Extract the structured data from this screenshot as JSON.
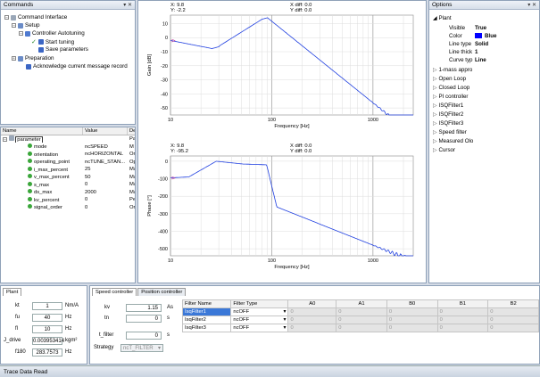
{
  "commands": {
    "title": "Commands",
    "controls": "▾ ✕",
    "tree": [
      "Command Interface",
      "Setup",
      "Controller Autotuning",
      "Start tuning",
      "Save parameters",
      "Preparation",
      "Acknowledge current message record"
    ]
  },
  "params": {
    "headers": [
      "Name",
      "Value",
      "De"
    ],
    "rows": [
      {
        "name": "parameter",
        "value": "",
        "desc": "Pa"
      },
      {
        "name": "mode",
        "value": "ncSPEED",
        "desc": "M"
      },
      {
        "name": "orientation",
        "value": "ncHORIZONTAL",
        "desc": "Ori"
      },
      {
        "name": "operating_point",
        "value": "ncTUNE_STAN...",
        "desc": "Op"
      },
      {
        "name": "i_max_percent",
        "value": "25",
        "desc": "Ma"
      },
      {
        "name": "v_max_percent",
        "value": "50",
        "desc": "Ma"
      },
      {
        "name": "s_max",
        "value": "0",
        "desc": "Ma"
      },
      {
        "name": "ds_max",
        "value": "2000",
        "desc": "Ma"
      },
      {
        "name": "kv_percent",
        "value": "0",
        "desc": "Per"
      },
      {
        "name": "signal_order",
        "value": "0",
        "desc": "On"
      }
    ]
  },
  "plot1": {
    "cursor_x": "X: 9.8",
    "cursor_y": "Y: -2.2",
    "xdiff": "X diff: 0.0",
    "ydiff": "Y diff: 0.0",
    "ylabel": "Gain [dB]",
    "xlabel": "Frequency [Hz]",
    "yticks": [
      "10",
      "0",
      "-10",
      "-20",
      "-30",
      "-40",
      "-50"
    ],
    "xticks": [
      "10",
      "100",
      "1000"
    ]
  },
  "plot2": {
    "cursor_x": "X: 9.8",
    "cursor_y": "Y: -95.2",
    "xdiff": "X diff: 0.0",
    "ydiff": "Y diff: 0.0",
    "ylabel": "Phase [°]",
    "xlabel": "Frequency [Hz]",
    "yticks": [
      "0",
      "-100",
      "-200",
      "-300",
      "-400",
      "-500"
    ],
    "xticks": [
      "10",
      "100",
      "1000"
    ]
  },
  "options": {
    "title": "Options",
    "controls": "▾ ✕",
    "plant": "Plant",
    "props": [
      {
        "k": "Visible",
        "v": "True"
      },
      {
        "k": "Color",
        "v": "Blue"
      },
      {
        "k": "Line type",
        "v": "Solid"
      },
      {
        "k": "Line thick",
        "v": "1"
      },
      {
        "k": "Curve typ",
        "v": "Line"
      }
    ],
    "items": [
      "1-mass appro",
      "Open Loop",
      "Closed Loop",
      "PI controller",
      "ISQFilter1",
      "ISQFilter2",
      "ISQFilter3",
      "Speed filter",
      "Measured Olo",
      "Cursor"
    ]
  },
  "plant_tab": {
    "tab": "Plant",
    "fields": [
      {
        "k": "kt",
        "v": "1",
        "u": "Nm/A"
      },
      {
        "k": "fu",
        "v": "40",
        "u": "Hz"
      },
      {
        "k": "fl",
        "v": "10",
        "u": "Hz"
      },
      {
        "k": "J_drive",
        "v": "0.003953414",
        "u": "kgm²"
      },
      {
        "k": "f180",
        "v": "283.7573",
        "u": "Hz"
      }
    ]
  },
  "ctrl": {
    "tabs": [
      "Speed controller",
      "Position controller"
    ],
    "kv": {
      "k": "kv",
      "v": "1.15",
      "u": "As"
    },
    "tn": {
      "k": "tn",
      "v": "0",
      "u": "s"
    },
    "tf": {
      "k": "t_filter",
      "v": "0",
      "u": "s"
    },
    "strategy_label": "Strategy",
    "strategy": "ncT_FILTER",
    "filter_headers": [
      "Filter Name",
      "Filter Type",
      "A0",
      "A1",
      "B0",
      "B1",
      "B2"
    ],
    "filters": [
      {
        "name": "IsqFilter1",
        "type": "ncOFF"
      },
      {
        "name": "IsqFilter2",
        "type": "ncOFF"
      },
      {
        "name": "IsqFilter3",
        "type": "ncOFF"
      }
    ],
    "filter_values": [
      "0",
      "0",
      "0",
      "0",
      "0"
    ]
  },
  "status": "Trace Data Read"
}
